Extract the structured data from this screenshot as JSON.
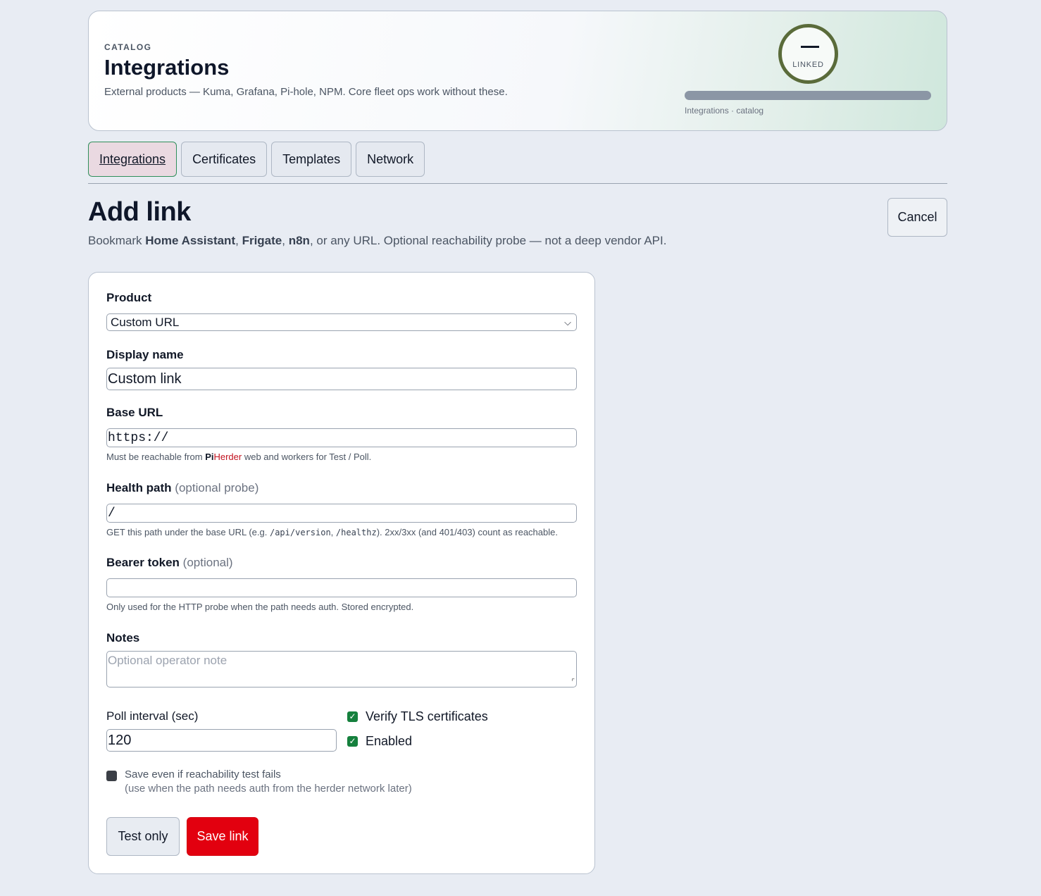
{
  "header": {
    "eyebrow": "CATALOG",
    "title": "Integrations",
    "subtitle": "External products — Kuma, Grafana, Pi-hole, NPM. Core fleet ops work without these.",
    "ring_value": "—",
    "ring_label": "LINKED",
    "progress_fraction": 0,
    "progress_caption": "Integrations · catalog"
  },
  "tabs": [
    {
      "label": "Integrations",
      "active": true
    },
    {
      "label": "Certificates",
      "active": false
    },
    {
      "label": "Templates",
      "active": false
    },
    {
      "label": "Network",
      "active": false
    }
  ],
  "page": {
    "title": "Add link",
    "subtitle_prefix": "Bookmark ",
    "product_1": "Home Assistant",
    "sep_1": ", ",
    "product_2": "Frigate",
    "sep_2": ", ",
    "product_3": "n8n",
    "subtitle_suffix": ", or any URL. Optional reachability probe — not a deep vendor API.",
    "cancel_label": "Cancel"
  },
  "form": {
    "product_label": "Product",
    "product_value": "Custom URL",
    "display_name_label": "Display name",
    "display_name_value": "Custom link",
    "base_url_label": "Base URL",
    "base_url_value": "https://",
    "base_url_help_prefix": "Must be reachable from ",
    "base_url_help_brand_1": "Pi",
    "base_url_help_brand_2": "Herder",
    "base_url_help_suffix": " web and workers for Test / Poll.",
    "health_label": "Health path",
    "health_optional": "(optional probe)",
    "health_value": "/",
    "health_help_1": "GET this path under the base URL (e.g. ",
    "health_help_code_1": "/api/version",
    "health_help_2": ", ",
    "health_help_code_2": "/healthz",
    "health_help_3": "). 2xx/3xx (and 401/403) count as reachable.",
    "token_label": "Bearer token",
    "token_optional": "(optional)",
    "token_value": "",
    "token_help": "Only used for the HTTP probe when the path needs auth. Stored encrypted.",
    "notes_label": "Notes",
    "notes_placeholder": "Optional operator note",
    "poll_label": "Poll interval (sec)",
    "poll_value": "120",
    "verify_tls_label": "Verify TLS certificates",
    "verify_tls_checked": true,
    "enabled_label": "Enabled",
    "enabled_checked": true,
    "save_anyway_label": "Save even if reachability test fails",
    "save_anyway_hint": "(use when the path needs auth from the herder network later)",
    "save_anyway_checked": false,
    "test_button": "Test only",
    "save_button": "Save link"
  },
  "colors": {
    "accent": "#2f8f5b",
    "danger": "#e2000f",
    "ring": "#5a6b3a"
  }
}
